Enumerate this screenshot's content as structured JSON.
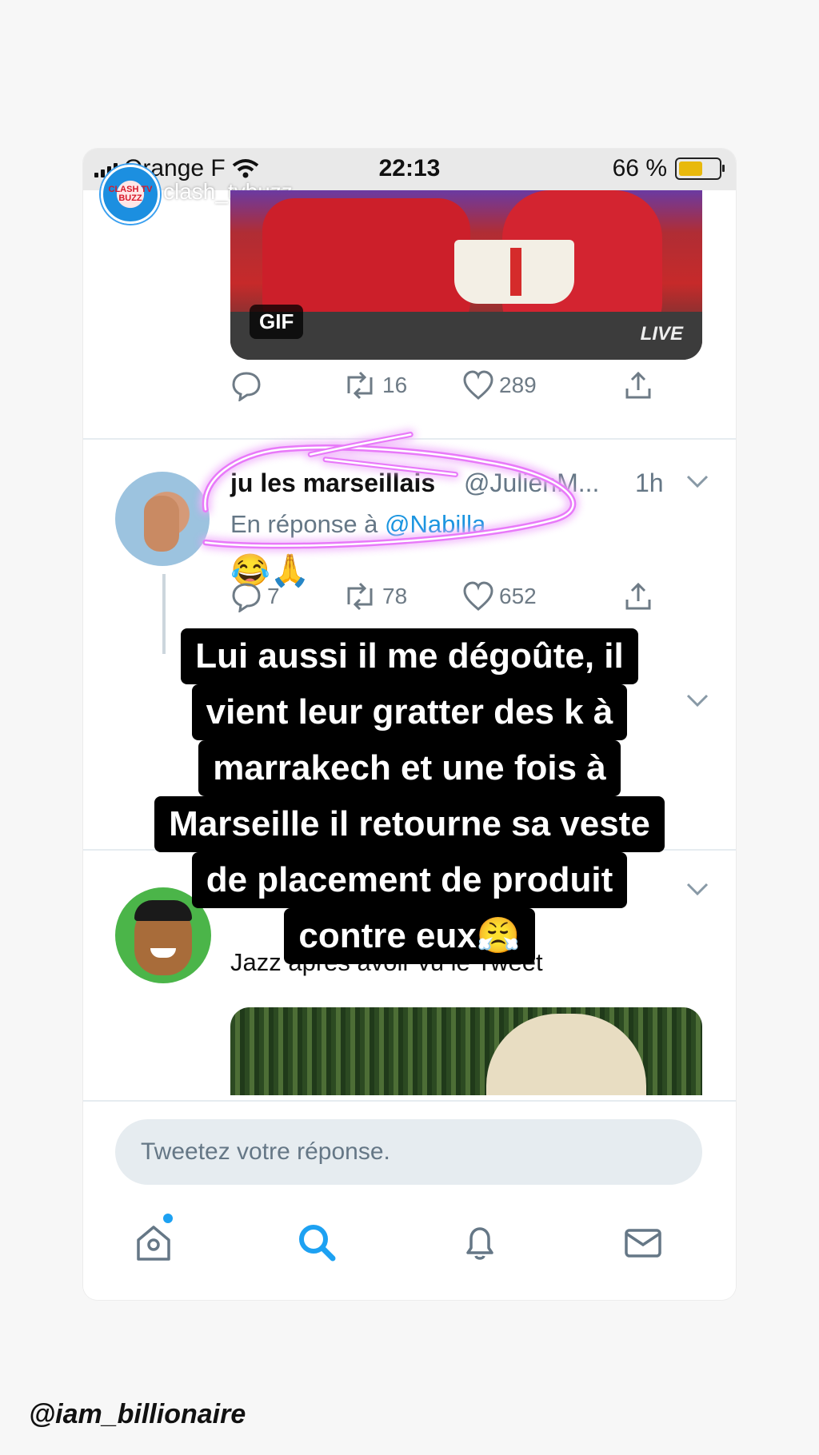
{
  "status_bar": {
    "carrier": "Orange F",
    "time": "22:13",
    "battery": "66 %",
    "battery_level": 0.66,
    "battery_color": "#e8b90c"
  },
  "story": {
    "badge_text": "CLASH TV BUZZ",
    "username": "clash_tvbuzz"
  },
  "tweet1": {
    "media_badge": "GIF",
    "media_overlay": "LIVE",
    "actions": {
      "reply": "",
      "retweet": "16",
      "like": "289"
    }
  },
  "tweet2": {
    "name": "ju les marseillais",
    "handle": "@JulienM...",
    "time": "1h",
    "reply_prefix": "En réponse à",
    "reply_mention": "@Nabilla",
    "emojis": "😂🙏",
    "actions": {
      "reply": "7",
      "retweet": "78",
      "like": "652"
    }
  },
  "tweet3": {
    "text": "Jazz après avoir vu le Tweet"
  },
  "caption": {
    "lines": [
      "Lui aussi il me dégoûte, il",
      "vient leur gratter des k à",
      "marrakech et une fois à",
      "Marseille il retourne sa veste",
      "de placement de produit",
      "contre eux😤"
    ]
  },
  "reply": {
    "placeholder": "Tweetez votre réponse."
  },
  "tabs": [
    "home-icon",
    "search-icon",
    "bell-icon",
    "mail-icon"
  ],
  "watermark": "@iam_billionaire",
  "colors": {
    "accent": "#1da1f2",
    "mention": "#1b95e0",
    "highlight": "#d946ef"
  }
}
